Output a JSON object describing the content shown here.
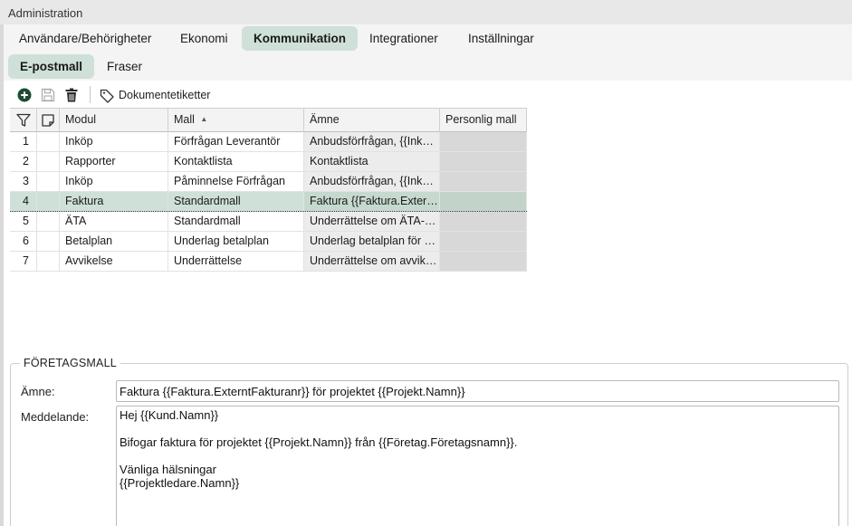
{
  "window": {
    "title": "Administration"
  },
  "main_tabs": [
    {
      "label": "Användare/Behörigheter",
      "active": false
    },
    {
      "label": "Ekonomi",
      "active": false
    },
    {
      "label": "Kommunikation",
      "active": true
    },
    {
      "label": "Integrationer",
      "active": false
    },
    {
      "label": "Inställningar",
      "active": false
    }
  ],
  "sub_tabs": [
    {
      "label": "E-postmall",
      "active": true
    },
    {
      "label": "Fraser",
      "active": false
    }
  ],
  "toolbar": {
    "add_icon": "plus-circle-icon",
    "save_icon": "save-icon",
    "delete_icon": "trash-icon",
    "tag_icon": "tag-icon",
    "tag_label": "Dokumentetiketter"
  },
  "grid": {
    "columns": {
      "filter_icon": "filter-icon",
      "note_icon": "note-icon",
      "modul": "Modul",
      "mall": "Mall",
      "mall_sort": "▲",
      "amne": "Ämne",
      "personlig": "Personlig mall"
    },
    "rows": [
      {
        "num": "1",
        "modul": "Inköp",
        "mall": "Förfrågan Leverantör",
        "amne": "Anbudsförfrågan, {{Inköp.Namn}}",
        "personlig": ""
      },
      {
        "num": "2",
        "modul": "Rapporter",
        "mall": "Kontaktlista",
        "amne": "Kontaktlista",
        "personlig": ""
      },
      {
        "num": "3",
        "modul": "Inköp",
        "mall": "Påminnelse Förfrågan",
        "amne": "Anbudsförfrågan, {{Inköp.Namn}}",
        "personlig": ""
      },
      {
        "num": "4",
        "modul": "Faktura",
        "mall": "Standardmall",
        "amne": "Faktura {{Faktura.ExterntFakturanr}}",
        "personlig": "",
        "selected": true
      },
      {
        "num": "5",
        "modul": "ÄTA",
        "mall": "Standardmall",
        "amne": "Underrättelse om ÄTA-arbete",
        "personlig": ""
      },
      {
        "num": "6",
        "modul": "Betalplan",
        "mall": "Underlag betalplan",
        "amne": "Underlag betalplan för projektet",
        "personlig": ""
      },
      {
        "num": "7",
        "modul": "Avvikelse",
        "mall": "Underrättelse",
        "amne": "Underrättelse om avvikelse",
        "personlig": ""
      }
    ]
  },
  "form": {
    "legend": "FÖRETAGSMALL",
    "amne_label": "Ämne:",
    "amne_value": "Faktura {{Faktura.ExterntFakturanr}} för projektet {{Projekt.Namn}}",
    "meddelande_label": "Meddelande:",
    "meddelande_value": "Hej {{Kund.Namn}}\n\nBifogar faktura för projektet {{Projekt.Namn}} från {{Företag.Företagsnamn}}.\n\nVänliga hälsningar\n{{Projektledare.Namn}}"
  },
  "colors": {
    "accent_tab": "#cfe0d8",
    "add_icon": "#1e4a35",
    "selected_row": "#cfe0d8"
  }
}
